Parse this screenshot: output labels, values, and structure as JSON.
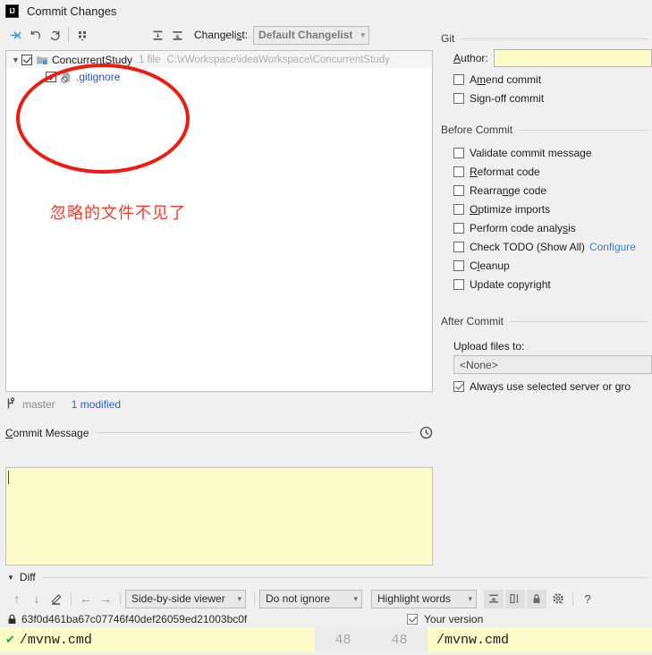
{
  "window": {
    "title": "Commit Changes",
    "logo_text": "IJ",
    "logo_icon": "intellij-idea-icon"
  },
  "changes_toolbar": {
    "buttons": [
      {
        "name": "move-to-changelist-icon",
        "glyph": "⇥"
      },
      {
        "name": "revert-icon",
        "glyph": "↺"
      },
      {
        "name": "refresh-icon",
        "glyph": "⟳"
      },
      {
        "name": "group-by-icon",
        "glyph": "⠿"
      },
      {
        "name": "expand-all-icon",
        "glyph": "⤓"
      },
      {
        "name": "collapse-all-icon",
        "glyph": "⤒"
      }
    ],
    "changelist_label": "Changelist:",
    "changelist_mnemonic": "s",
    "changelist_value": "Default Changelist",
    "changelist_options": [
      "Default Changelist"
    ]
  },
  "changes_tree": {
    "root": {
      "label": "ConcurrentStudy",
      "checked": true,
      "expanded": true,
      "file_count": "1 file",
      "path": "C:\\xWorkspace\\ideaWorkspace\\ConcurrentStudy",
      "icon": "module-folder-icon"
    },
    "children": [
      {
        "label": ".gitignore",
        "checked": true,
        "icon": "ignored-file-icon"
      }
    ]
  },
  "annotation": {
    "text": "忽略的文件不见了",
    "color": "#f73a28",
    "ellipse_color": "#ee1b10"
  },
  "status": {
    "branch_icon": "branch-icon",
    "branch": "master",
    "modified": "1 modified"
  },
  "commit_message": {
    "title": "Commit Message",
    "mnemonic": "C",
    "value": "",
    "history_icon": "history-clock-icon"
  },
  "git_section": {
    "title": "Git",
    "author_label": "Author:",
    "author_mnemonic": "A",
    "author_value": "",
    "checkboxes": [
      {
        "label": "Amend commit",
        "mnemonic": "m",
        "checked": false,
        "name": "amend-commit-checkbox"
      },
      {
        "label": "Sign-off commit",
        "mnemonic": "g",
        "checked": false,
        "name": "sign-off-commit-checkbox"
      }
    ]
  },
  "before_commit": {
    "title": "Before Commit",
    "checkboxes": [
      {
        "label": "Validate commit message",
        "mnemonic": "",
        "checked": false,
        "name": "validate-commit-message-checkbox"
      },
      {
        "label": "Reformat code",
        "mnemonic": "R",
        "checked": false,
        "name": "reformat-code-checkbox"
      },
      {
        "label": "Rearrange code",
        "mnemonic": "n",
        "checked": false,
        "name": "rearrange-code-checkbox"
      },
      {
        "label": "Optimize imports",
        "mnemonic": "O",
        "checked": false,
        "name": "optimize-imports-checkbox"
      },
      {
        "label": "Perform code analysis",
        "mnemonic": "s",
        "checked": false,
        "name": "perform-code-analysis-checkbox"
      },
      {
        "label": "Check TODO (Show All)",
        "mnemonic": "",
        "checked": false,
        "name": "check-todo-checkbox",
        "link": "Configure"
      },
      {
        "label": "Cleanup",
        "mnemonic": "l",
        "checked": false,
        "name": "cleanup-checkbox"
      },
      {
        "label": "Update copyright",
        "mnemonic": "",
        "checked": false,
        "name": "update-copyright-checkbox"
      }
    ]
  },
  "after_commit": {
    "title": "After Commit",
    "upload_label": "Upload files to:",
    "upload_value": "<None>",
    "upload_options": [
      "<None>"
    ],
    "always_use_label": "Always use selected server or gro",
    "always_use_checked": true
  },
  "diff": {
    "title": "Diff",
    "expanded": true,
    "toolbar": [
      {
        "name": "previous-difference-icon",
        "glyph": "↑"
      },
      {
        "name": "next-difference-icon",
        "glyph": "↓"
      },
      {
        "name": "edit-source-icon",
        "glyph": "✎"
      },
      {
        "name": "accept-left-icon",
        "glyph": "←"
      },
      {
        "name": "accept-right-icon",
        "glyph": "→"
      }
    ],
    "viewer_mode": "Side-by-side viewer",
    "viewer_options": [
      "Side-by-side viewer"
    ],
    "whitespace_mode": "Do not ignore",
    "whitespace_options": [
      "Do not ignore"
    ],
    "highlight_mode": "Highlight words",
    "highlight_options": [
      "Highlight words"
    ],
    "toggle_buttons": [
      {
        "name": "collapse-unchanged-fragments-icon",
        "glyph": "⤒",
        "active": true
      },
      {
        "name": "synchronize-scrolling-icon",
        "glyph": "◫",
        "active": true
      },
      {
        "name": "read-only-lock-icon",
        "glyph": "🔒",
        "active": true
      },
      {
        "name": "diff-settings-gear-icon",
        "glyph": "⚙",
        "active": false
      },
      {
        "name": "diff-help-icon",
        "glyph": "?",
        "active": false
      }
    ],
    "left_title": "63f0d461ba67c07746f40def26059ed21003bc0f",
    "left_title_icon": "lock-icon",
    "right_title": "Your version",
    "right_title_checked": true,
    "row": {
      "left_text": "/mvnw.cmd",
      "left_status_icon": "check-green-icon",
      "line_number_left": "48",
      "line_number_right": "48",
      "right_text": "/mvnw.cmd"
    }
  }
}
